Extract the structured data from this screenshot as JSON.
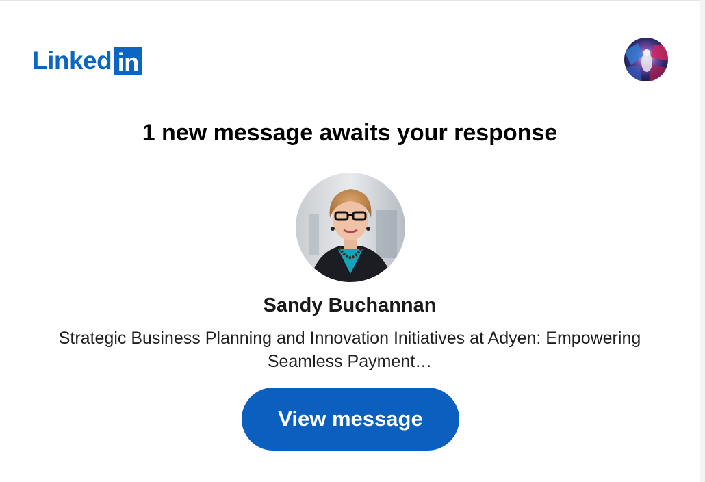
{
  "brand": {
    "logo_word": "Linked",
    "logo_box_text": "in",
    "color": "#0a66c2"
  },
  "header": {
    "account_avatar_icon": "user-avatar-icon"
  },
  "notification": {
    "headline": "1 new message awaits your response"
  },
  "sender": {
    "name": "Sandy Buchannan",
    "headline": "Strategic Business Planning and Innovation Initiatives at Adyen: Empowering Seamless Payment…",
    "photo_icon": "profile-photo-icon"
  },
  "cta": {
    "label": "View message",
    "color": "#0a5fbf"
  }
}
